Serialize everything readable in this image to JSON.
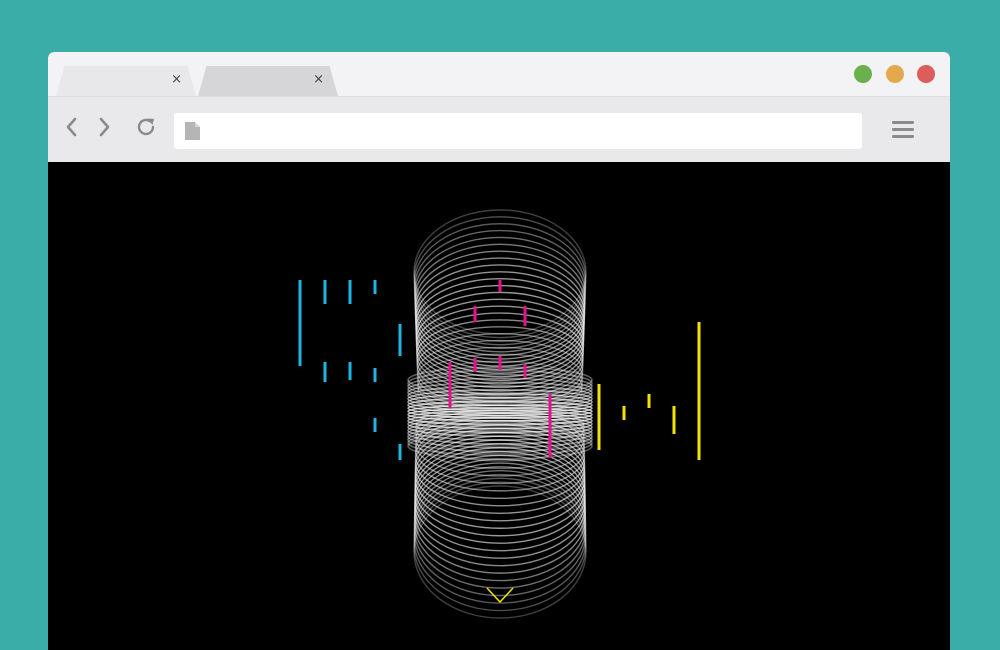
{
  "tabs": [
    {
      "close_glyph": "×",
      "state": "active"
    },
    {
      "close_glyph": "×",
      "state": "inactive"
    }
  ],
  "window_controls": {
    "colors": {
      "green": "#6ab04c",
      "yellow": "#e3a94c",
      "red": "#dd5c5c"
    }
  },
  "toolbar": {
    "back_icon": "chevron-left-icon",
    "forward_icon": "chevron-right-icon",
    "reload_icon": "reload-icon",
    "menu_icon": "hamburger-menu-icon"
  },
  "address_bar": {
    "value": "",
    "icon": "page-icon"
  },
  "content": {
    "background": "#000000",
    "graphic": "slinky-rings",
    "accent_colors": {
      "cyan": "#1eb4e6",
      "magenta": "#e6128c",
      "yellow": "#f2e400"
    },
    "scroll_hint_icon": "chevron-down-icon"
  }
}
